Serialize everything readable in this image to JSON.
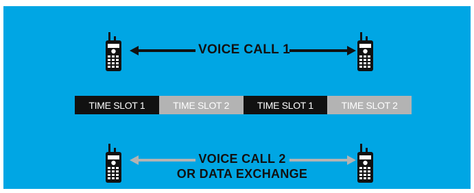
{
  "top_call": {
    "label": "VOICE CALL 1",
    "arrow_color": "#111111"
  },
  "time_slots": [
    {
      "label": "TIME SLOT 1",
      "style": "dark"
    },
    {
      "label": "TIME SLOT 2",
      "style": "light"
    },
    {
      "label": "TIME SLOT 1",
      "style": "dark"
    },
    {
      "label": "TIME SLOT 2",
      "style": "light"
    }
  ],
  "bottom_call": {
    "line1": "VOICE CALL 2",
    "line2": "OR DATA EXCHANGE",
    "arrow_color": "#b3b3b3"
  },
  "colors": {
    "background": "#00a6e4",
    "slot_dark": "#111111",
    "slot_light": "#b3b3b3",
    "radio_body": "#111111",
    "radio_detail": "#ffffff"
  },
  "icons": {
    "radio": "two-way-radio-icon"
  }
}
